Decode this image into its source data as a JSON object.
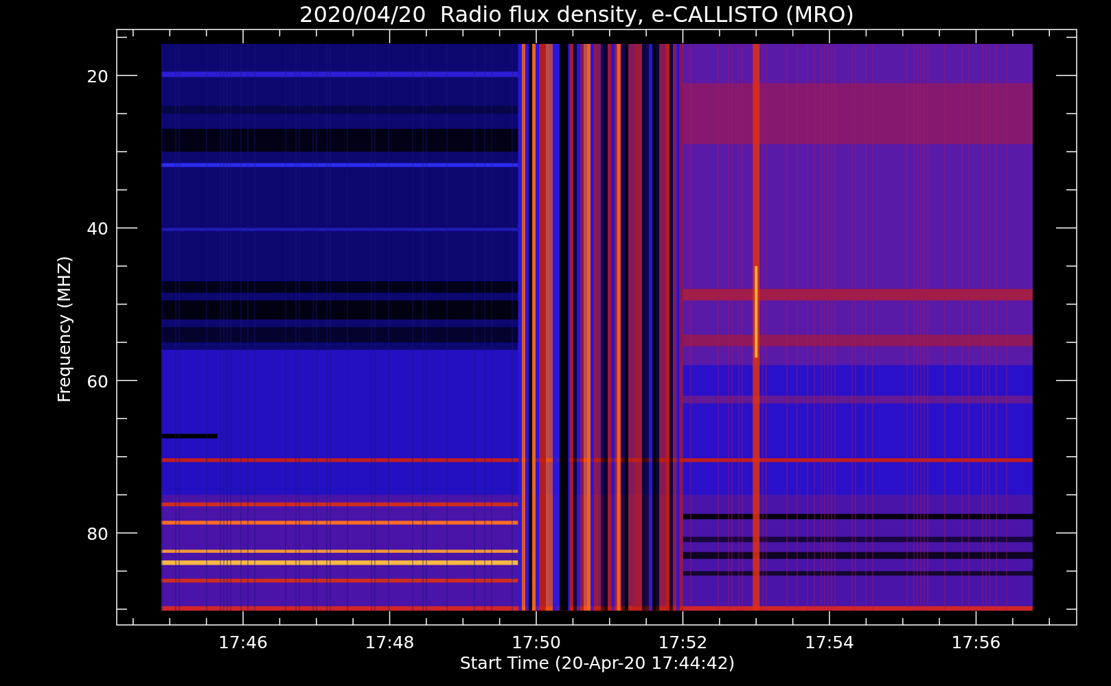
{
  "title": "2020/04/20  Radio flux density, e-CALLISTO (MRO)",
  "y_axis": {
    "label": "Frequency (MHZ)",
    "ticks": [
      "20",
      "40",
      "60",
      "80"
    ]
  },
  "x_axis": {
    "label": "Start Time (20-Apr-20 17:44:42)",
    "ticks": [
      "17:46",
      "17:48",
      "17:50",
      "17:52",
      "17:54",
      "17:56"
    ]
  }
}
